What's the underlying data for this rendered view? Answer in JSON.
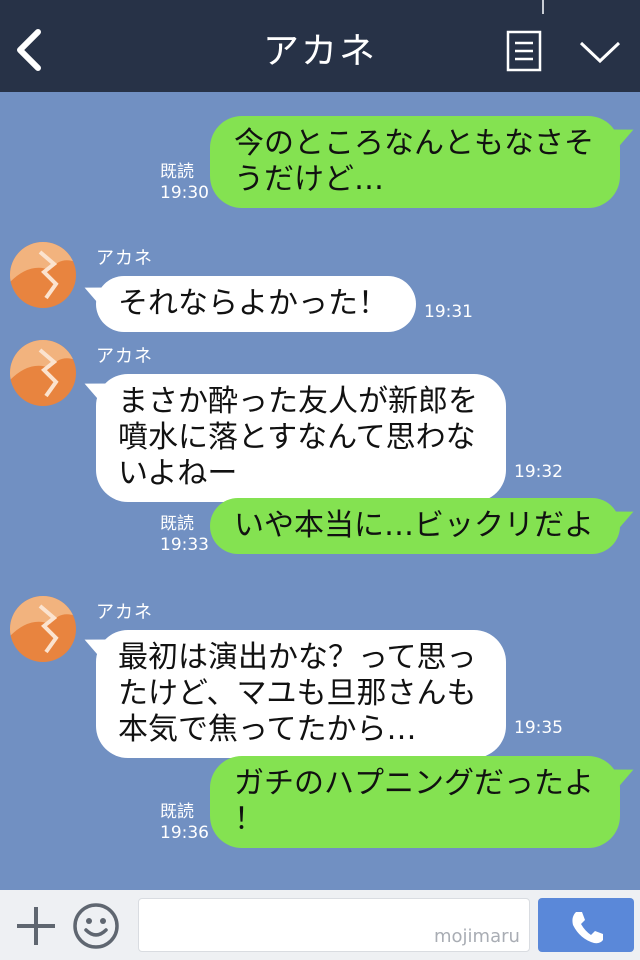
{
  "header": {
    "title": "アカネ"
  },
  "messages": [
    {
      "side": "out",
      "text": "今のところなんともなさそ\nうだけど…",
      "read": "既読",
      "time": "19:30"
    },
    {
      "side": "in",
      "sender": "アカネ",
      "text": "それならよかった！",
      "time": "19:31"
    },
    {
      "side": "in",
      "sender": "アカネ",
      "text": "まさか酔った友人が新郎を\n噴水に落とすなんて思わな\nいよねー",
      "time": "19:32"
    },
    {
      "side": "out",
      "text": "いや本当に…ビックリだよ",
      "read": "既読",
      "time": "19:33"
    },
    {
      "side": "in",
      "sender": "アカネ",
      "text": "最初は演出かな？って思っ\nたけど、マユも旦那さんも\n本気で焦ってたから…",
      "time": "19:35"
    },
    {
      "side": "out",
      "text": "ガチのハプニングだったよ\n！",
      "read": "既読",
      "time": "19:36"
    }
  ],
  "input": {
    "placeholder": "",
    "watermark": "mojimaru"
  },
  "colors": {
    "header_bg": "#273247",
    "chat_bg": "#7190c2",
    "out_bubble": "#84e251",
    "in_bubble": "#ffffff",
    "call_button": "#5a88d9"
  }
}
